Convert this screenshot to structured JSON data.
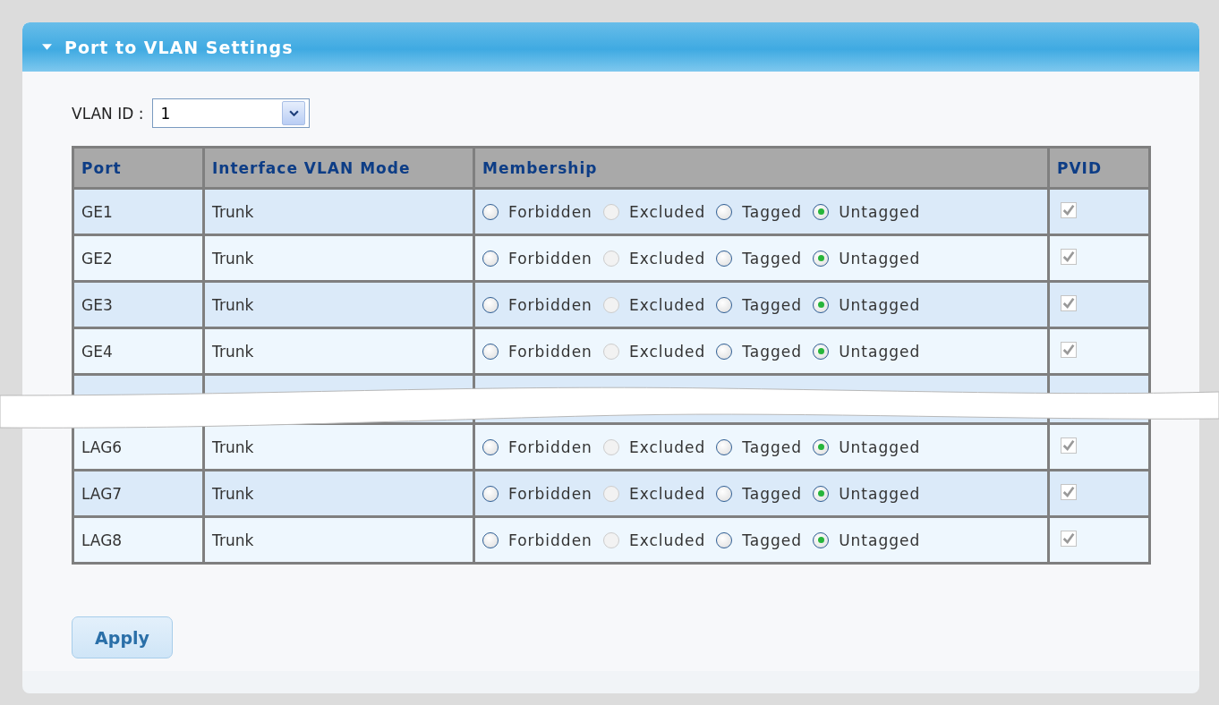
{
  "panel": {
    "title": "Port to VLAN Settings",
    "expanded": true
  },
  "vlan_id": {
    "label": "VLAN ID :",
    "value": "1"
  },
  "table": {
    "columns": [
      "Port",
      "Interface VLAN Mode",
      "Membership",
      "PVID"
    ],
    "rows": [
      {
        "port": "GE1",
        "mode": "Trunk",
        "options": [
          {
            "label": "Forbidden",
            "selected": false,
            "disabled": false
          },
          {
            "label": "Excluded",
            "selected": false,
            "disabled": true
          },
          {
            "label": "Tagged",
            "selected": false,
            "disabled": false
          },
          {
            "label": "Untagged",
            "selected": true,
            "disabled": false
          }
        ],
        "pvid": {
          "checked": true,
          "disabled": true
        }
      },
      {
        "port": "GE2",
        "mode": "Trunk",
        "options": [
          {
            "label": "Forbidden",
            "selected": false,
            "disabled": false
          },
          {
            "label": "Excluded",
            "selected": false,
            "disabled": true
          },
          {
            "label": "Tagged",
            "selected": false,
            "disabled": false
          },
          {
            "label": "Untagged",
            "selected": true,
            "disabled": false
          }
        ],
        "pvid": {
          "checked": true,
          "disabled": true
        }
      },
      {
        "port": "GE3",
        "mode": "Trunk",
        "options": [
          {
            "label": "Forbidden",
            "selected": false,
            "disabled": false
          },
          {
            "label": "Excluded",
            "selected": false,
            "disabled": true
          },
          {
            "label": "Tagged",
            "selected": false,
            "disabled": false
          },
          {
            "label": "Untagged",
            "selected": true,
            "disabled": false
          }
        ],
        "pvid": {
          "checked": true,
          "disabled": true
        }
      },
      {
        "port": "GE4",
        "mode": "Trunk",
        "options": [
          {
            "label": "Forbidden",
            "selected": false,
            "disabled": false
          },
          {
            "label": "Excluded",
            "selected": false,
            "disabled": true
          },
          {
            "label": "Tagged",
            "selected": false,
            "disabled": false
          },
          {
            "label": "Untagged",
            "selected": true,
            "disabled": false
          }
        ],
        "pvid": {
          "checked": true,
          "disabled": true
        }
      },
      {
        "kind": "break"
      },
      {
        "port": "LAG6",
        "mode": "Trunk",
        "options": [
          {
            "label": "Forbidden",
            "selected": false,
            "disabled": false
          },
          {
            "label": "Excluded",
            "selected": false,
            "disabled": true
          },
          {
            "label": "Tagged",
            "selected": false,
            "disabled": false
          },
          {
            "label": "Untagged",
            "selected": true,
            "disabled": false
          }
        ],
        "pvid": {
          "checked": true,
          "disabled": true
        }
      },
      {
        "port": "LAG7",
        "mode": "Trunk",
        "options": [
          {
            "label": "Forbidden",
            "selected": false,
            "disabled": false
          },
          {
            "label": "Excluded",
            "selected": false,
            "disabled": true
          },
          {
            "label": "Tagged",
            "selected": false,
            "disabled": false
          },
          {
            "label": "Untagged",
            "selected": true,
            "disabled": false
          }
        ],
        "pvid": {
          "checked": true,
          "disabled": true
        }
      },
      {
        "port": "LAG8",
        "mode": "Trunk",
        "options": [
          {
            "label": "Forbidden",
            "selected": false,
            "disabled": false
          },
          {
            "label": "Excluded",
            "selected": false,
            "disabled": true
          },
          {
            "label": "Tagged",
            "selected": false,
            "disabled": false
          },
          {
            "label": "Untagged",
            "selected": true,
            "disabled": false
          }
        ],
        "pvid": {
          "checked": true,
          "disabled": true
        }
      }
    ]
  },
  "buttons": [
    "Apply"
  ]
}
